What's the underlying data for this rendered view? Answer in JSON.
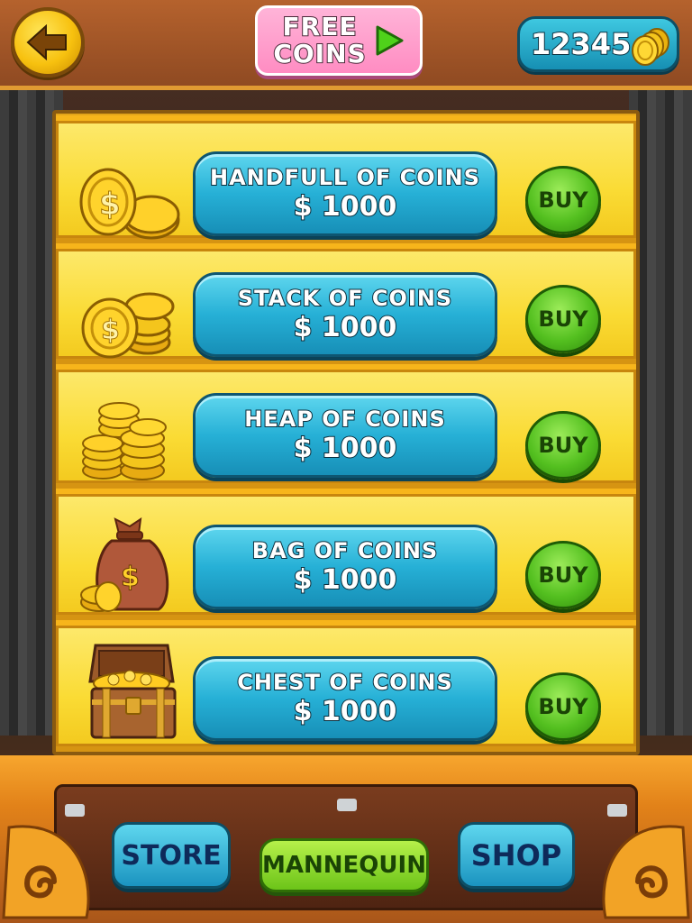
{
  "header": {
    "free_coins_line1": "FREE",
    "free_coins_line2": "COINS",
    "coin_balance": "12345"
  },
  "shop_items": [
    {
      "name": "HANDFULL OF COINS",
      "price": "$ 1000",
      "buy_label": "BUY",
      "icon": "coin-handful-icon"
    },
    {
      "name": "STACK OF COINS",
      "price": "$ 1000",
      "buy_label": "BUY",
      "icon": "coin-stack-icon"
    },
    {
      "name": "HEAP OF COINS",
      "price": "$ 1000",
      "buy_label": "BUY",
      "icon": "coin-heap-icon"
    },
    {
      "name": "BAG OF COINS",
      "price": "$ 1000",
      "buy_label": "BUY",
      "icon": "coin-bag-icon"
    },
    {
      "name": "CHEST OF COINS",
      "price": "$ 1000",
      "buy_label": "BUY",
      "icon": "treasure-chest-icon"
    }
  ],
  "nav": {
    "store": "STORE",
    "mannequin": "MANNEQUIN",
    "shop": "SHOP"
  },
  "colors": {
    "shelf_yellow": "#fadb34",
    "pack_blue": "#26b0d6",
    "buy_green": "#54c020",
    "free_pink": "#ff8cc2"
  }
}
